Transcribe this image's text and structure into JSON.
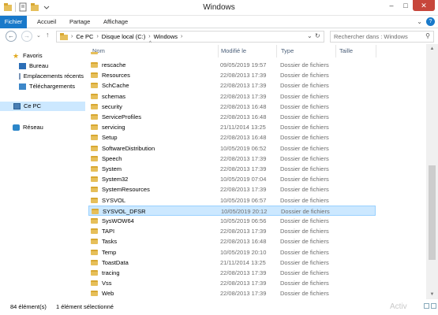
{
  "window": {
    "title": "Windows",
    "minimize": "–",
    "maximize": "□",
    "close": "✕"
  },
  "ribbon": {
    "tabs": [
      "Fichier",
      "Accueil",
      "Partage",
      "Affichage"
    ],
    "help": "?"
  },
  "address": {
    "path": [
      "Ce PC",
      "Disque local (C:)",
      "Windows"
    ],
    "search_placeholder": "Rechercher dans : Windows"
  },
  "navpane": {
    "favoris": "Favoris",
    "bureau": "Bureau",
    "emplacements": "Emplacements récents",
    "telechargements": "Téléchargements",
    "cepc": "Ce PC",
    "reseau": "Réseau"
  },
  "columns": {
    "name": "Nom",
    "modified": "Modifié le",
    "type": "Type",
    "size": "Taille"
  },
  "files": [
    {
      "name": "rescache",
      "date": "09/05/2019 19:57",
      "type": "Dossier de fichiers"
    },
    {
      "name": "Resources",
      "date": "22/08/2013 17:39",
      "type": "Dossier de fichiers"
    },
    {
      "name": "SchCache",
      "date": "22/08/2013 17:39",
      "type": "Dossier de fichiers"
    },
    {
      "name": "schemas",
      "date": "22/08/2013 17:39",
      "type": "Dossier de fichiers"
    },
    {
      "name": "security",
      "date": "22/08/2013 16:48",
      "type": "Dossier de fichiers"
    },
    {
      "name": "ServiceProfiles",
      "date": "22/08/2013 16:48",
      "type": "Dossier de fichiers"
    },
    {
      "name": "servicing",
      "date": "21/11/2014 13:25",
      "type": "Dossier de fichiers"
    },
    {
      "name": "Setup",
      "date": "22/08/2013 16:48",
      "type": "Dossier de fichiers"
    },
    {
      "name": "SoftwareDistribution",
      "date": "10/05/2019 06:52",
      "type": "Dossier de fichiers"
    },
    {
      "name": "Speech",
      "date": "22/08/2013 17:39",
      "type": "Dossier de fichiers"
    },
    {
      "name": "System",
      "date": "22/08/2013 17:39",
      "type": "Dossier de fichiers"
    },
    {
      "name": "System32",
      "date": "10/05/2019 07:04",
      "type": "Dossier de fichiers"
    },
    {
      "name": "SystemResources",
      "date": "22/08/2013 17:39",
      "type": "Dossier de fichiers"
    },
    {
      "name": "SYSVOL",
      "date": "10/05/2019 06:57",
      "type": "Dossier de fichiers"
    },
    {
      "name": "SYSVOL_DFSR",
      "date": "10/05/2019 20:12",
      "type": "Dossier de fichiers"
    },
    {
      "name": "SysWOW64",
      "date": "10/05/2019 06:56",
      "type": "Dossier de fichiers"
    },
    {
      "name": "TAPI",
      "date": "22/08/2013 17:39",
      "type": "Dossier de fichiers"
    },
    {
      "name": "Tasks",
      "date": "22/08/2013 16:48",
      "type": "Dossier de fichiers"
    },
    {
      "name": "Temp",
      "date": "10/05/2019 20:10",
      "type": "Dossier de fichiers"
    },
    {
      "name": "ToastData",
      "date": "21/11/2014 13:25",
      "type": "Dossier de fichiers"
    },
    {
      "name": "tracing",
      "date": "22/08/2013 17:39",
      "type": "Dossier de fichiers"
    },
    {
      "name": "Vss",
      "date": "22/08/2013 17:39",
      "type": "Dossier de fichiers"
    },
    {
      "name": "Web",
      "date": "22/08/2013 17:39",
      "type": "Dossier de fichiers"
    }
  ],
  "status": {
    "count": "84 élément(s)",
    "selected": "1 élément sélectionné",
    "watermark": "Activ"
  },
  "colors": {
    "accent": "#1979ca",
    "selection": "#cce8ff",
    "folder": "#e6bf5a"
  }
}
